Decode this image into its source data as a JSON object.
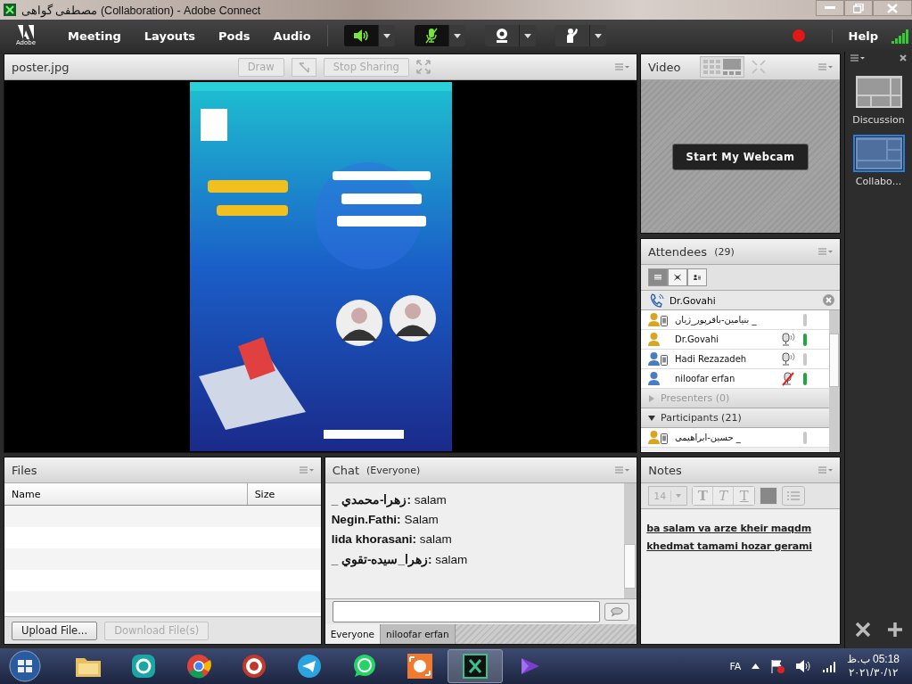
{
  "window": {
    "title": "مصطفی گواهی (Collaboration) - Adobe Connect"
  },
  "menu_bar": {
    "logo": "Adobe",
    "items": [
      "Meeting",
      "Layouts",
      "Pods",
      "Audio"
    ],
    "controls": [
      {
        "kind": "speaker",
        "on": true
      },
      {
        "kind": "mic",
        "on": true
      },
      {
        "kind": "webcam",
        "on": false
      },
      {
        "kind": "hand",
        "on": false
      }
    ],
    "recording": true,
    "help": "Help"
  },
  "share_pod": {
    "title": "poster.jpg",
    "buttons": [
      {
        "label": "Draw",
        "disabled": true
      },
      {
        "label": "Stop Sharing",
        "disabled": true
      }
    ]
  },
  "video_pod": {
    "title": "Video",
    "button": "Start My Webcam"
  },
  "attendees": {
    "title": "Attendees",
    "count": "(29)",
    "views": [
      {
        "kind": "list",
        "selected": true
      },
      {
        "kind": "grid",
        "selected": false
      },
      {
        "kind": "presenter",
        "selected": false
      }
    ],
    "phone_user": "Dr.Govahi",
    "rows": [
      {
        "name": "_ بنیامین-باقرپور_ژیان",
        "color": "#d9a520",
        "mobile": true,
        "mic_on": false,
        "mic_muted": false,
        "talking": false
      },
      {
        "name": "Dr.Govahi",
        "color": "#d9a520",
        "mobile": false,
        "mic_on": true,
        "mic_muted": false,
        "talking": true
      },
      {
        "name": "Hadi Rezazadeh",
        "color": "#4a7cc4",
        "mobile": true,
        "mic_on": true,
        "mic_muted": false,
        "talking": false
      },
      {
        "name": "niloofar erfan",
        "color": "#4a7cc4",
        "mobile": false,
        "mic_on": false,
        "mic_muted": true,
        "talking": true
      }
    ],
    "sections": [
      {
        "label": "Presenters (0)",
        "expanded": false
      },
      {
        "label": "Participants (21)",
        "expanded": true,
        "rows": [
          {
            "name": "_ حسین-ابراهیمی",
            "color": "#d9a520",
            "mobile": true,
            "mic_on": false,
            "mic_muted": false,
            "talking": false
          }
        ]
      }
    ]
  },
  "files": {
    "title": "Files",
    "columns": [
      "Name",
      "Size"
    ],
    "buttons": [
      {
        "label": "Upload File...",
        "disabled": false
      },
      {
        "label": "Download File(s)",
        "disabled": true
      }
    ]
  },
  "chat": {
    "title": "Chat",
    "scope": "(Everyone)",
    "messages": [
      {
        "sender": "_ زهرا-محمدي:",
        "text": "salam"
      },
      {
        "sender": "Negin.Fathi:",
        "text": "Salam"
      },
      {
        "sender": "lida khorasani:",
        "text": "salam"
      },
      {
        "sender": "_ زهرا_سيده-تقوي:",
        "text": "salam"
      }
    ],
    "tabs": [
      {
        "label": "Everyone",
        "selected": true
      },
      {
        "label": "niloofar erfan",
        "selected": false
      }
    ]
  },
  "notes": {
    "title": "Notes",
    "font_size": "14",
    "format_buttons": [
      {
        "kind": "bold",
        "label": "T"
      },
      {
        "kind": "italic",
        "label": "T"
      },
      {
        "kind": "underline",
        "label": "T"
      }
    ],
    "text": "ba salam va arze kheir maqdm khedmat tamami hozar gerami"
  },
  "layouts": [
    {
      "label": "Discussion",
      "selected": false
    },
    {
      "label": "Collabo...",
      "selected": true
    }
  ],
  "taskbar": {
    "apps": [
      {
        "kind": "explorer",
        "active": false
      },
      {
        "kind": "antivirus",
        "active": false
      },
      {
        "kind": "browser",
        "active": false
      },
      {
        "kind": "vpn",
        "active": false
      },
      {
        "kind": "messenger",
        "active": false
      },
      {
        "kind": "chat",
        "active": false
      },
      {
        "kind": "recorder",
        "active": false
      },
      {
        "kind": "connect",
        "active": true
      },
      {
        "kind": "studio",
        "active": false
      }
    ],
    "language": "FA",
    "time": "05:18 ب.ظ",
    "date": "۲۰۲۱/۳۰/۱۲"
  }
}
